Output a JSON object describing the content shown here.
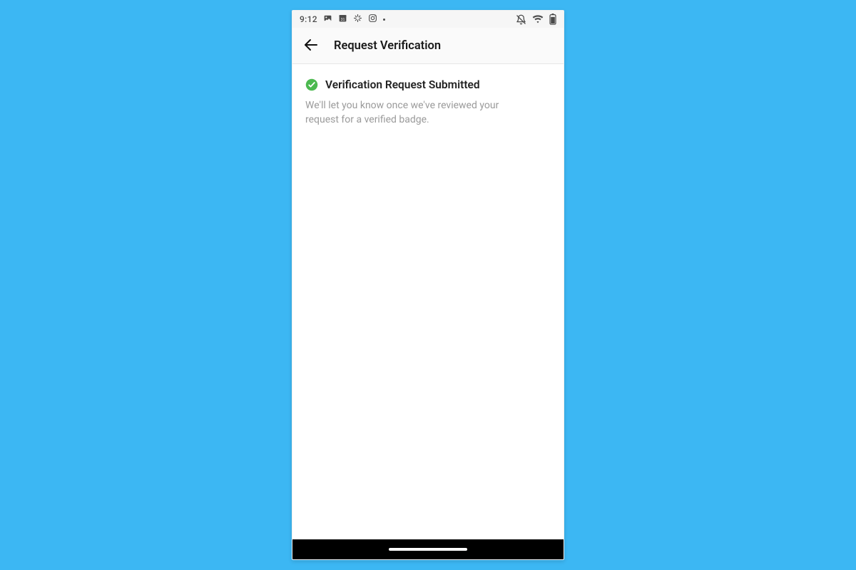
{
  "status": {
    "clock": "9:12",
    "icons_left": [
      "photos-icon",
      "calendar-icon",
      "sync-icon",
      "instagram-icon",
      "dot-icon"
    ],
    "icons_right": [
      "dnd-off-icon",
      "wifi-icon",
      "battery-icon"
    ]
  },
  "appbar": {
    "back_label": "Back",
    "title": "Request Verification"
  },
  "content": {
    "success_title": "Verification Request Submitted",
    "success_desc": "We'll let you know once we've reviewed your request for a verified badge.",
    "badge_color": "#4cb950"
  }
}
